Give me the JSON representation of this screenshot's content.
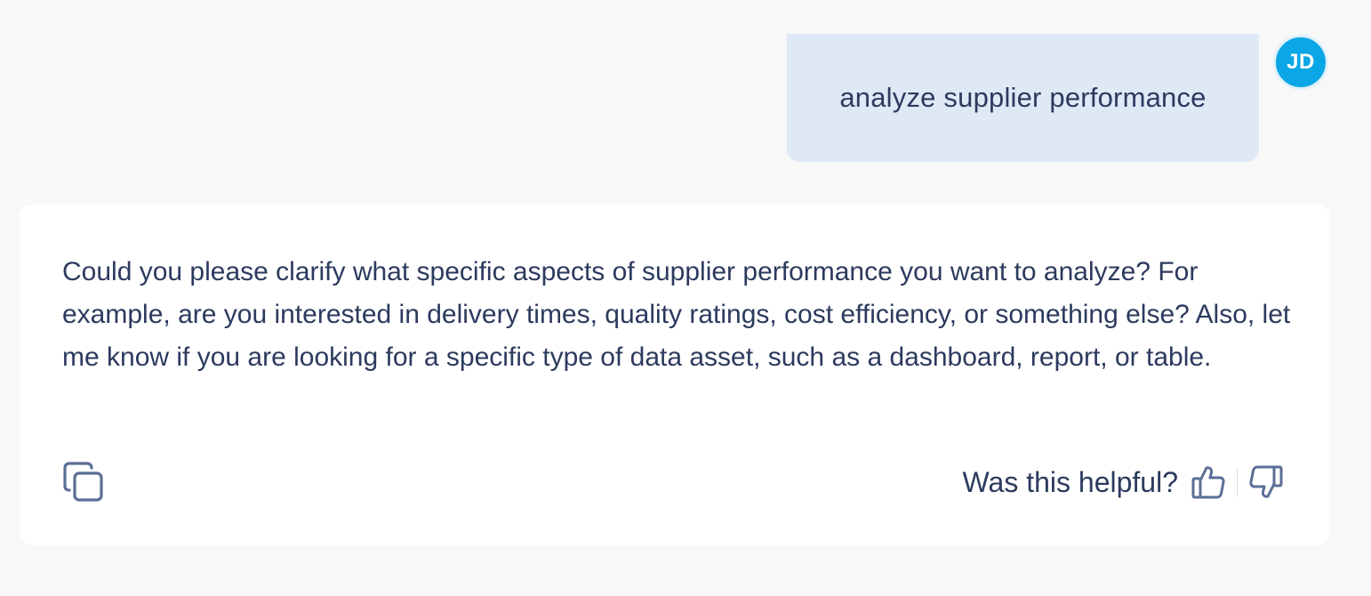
{
  "user_message": {
    "text": "analyze supplier performance",
    "avatar_initials": "JD"
  },
  "assistant_message": {
    "text": "Could you please clarify what specific aspects of supplier performance you want to analyze? For example, are you interested in delivery times, quality ratings, cost efficiency, or something else? Also, let me know if you are looking for a specific type of data asset, such as a dashboard, report, or table."
  },
  "actions": {
    "copy_icon": "copy-icon",
    "feedback_label": "Was this helpful?",
    "thumbs_up_icon": "thumbs-up-icon",
    "thumbs_down_icon": "thumbs-down-icon"
  },
  "colors": {
    "background": "#f8f8f9",
    "user_bubble": "#dfe9f6",
    "avatar": "#0aa6e6",
    "text": "#2c3a5e",
    "icon": "#5b6e96"
  }
}
